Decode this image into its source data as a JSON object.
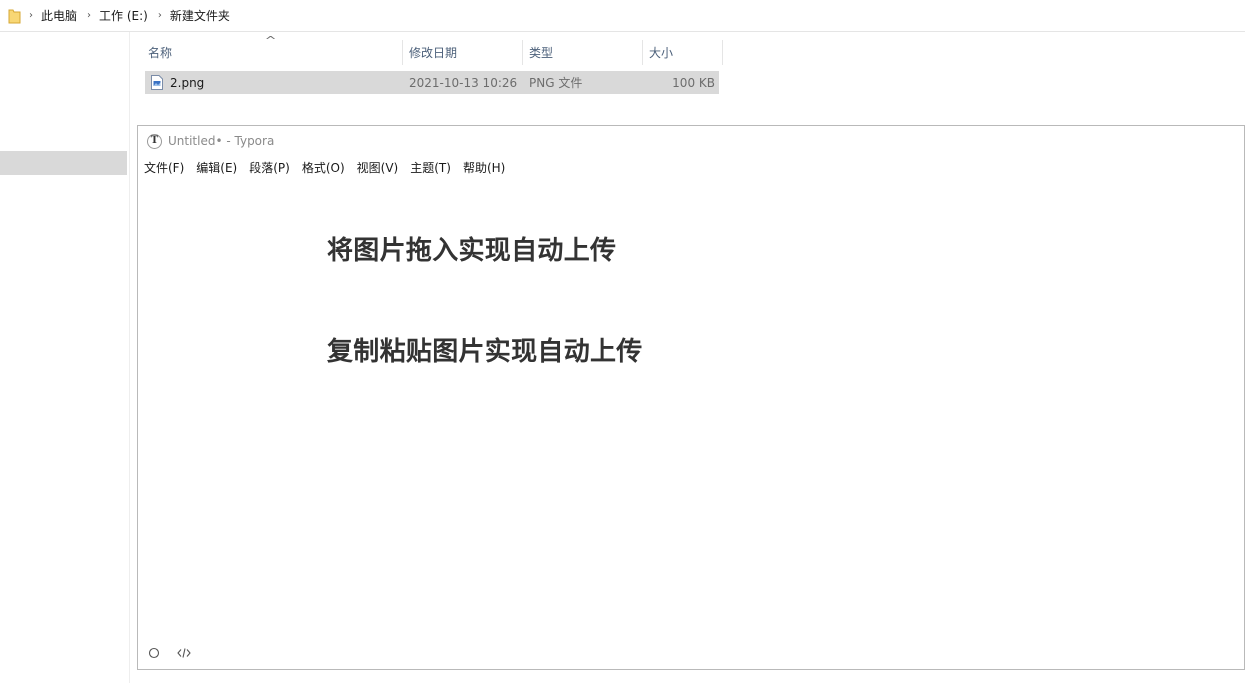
{
  "explorer": {
    "breadcrumb": [
      "此电脑",
      "工作 (E:)",
      "新建文件夹"
    ],
    "columns": {
      "name": "名称",
      "modified": "修改日期",
      "type": "类型",
      "size": "大小"
    },
    "files": [
      {
        "name": "2.png",
        "modified": "2021-10-13 10:26",
        "type": "PNG 文件",
        "size": "100 KB"
      }
    ]
  },
  "typora": {
    "title": "Untitled• - Typora",
    "menu": [
      "文件(F)",
      "编辑(E)",
      "段落(P)",
      "格式(O)",
      "视图(V)",
      "主题(T)",
      "帮助(H)"
    ],
    "headings": [
      "将图片拖入实现自动上传",
      "复制粘贴图片实现自动上传"
    ]
  },
  "colors": {
    "selection": "#d9d9d9",
    "header_text": "#4c607a",
    "heading_text": "#333333",
    "folder_yellow": "#f8d775"
  }
}
